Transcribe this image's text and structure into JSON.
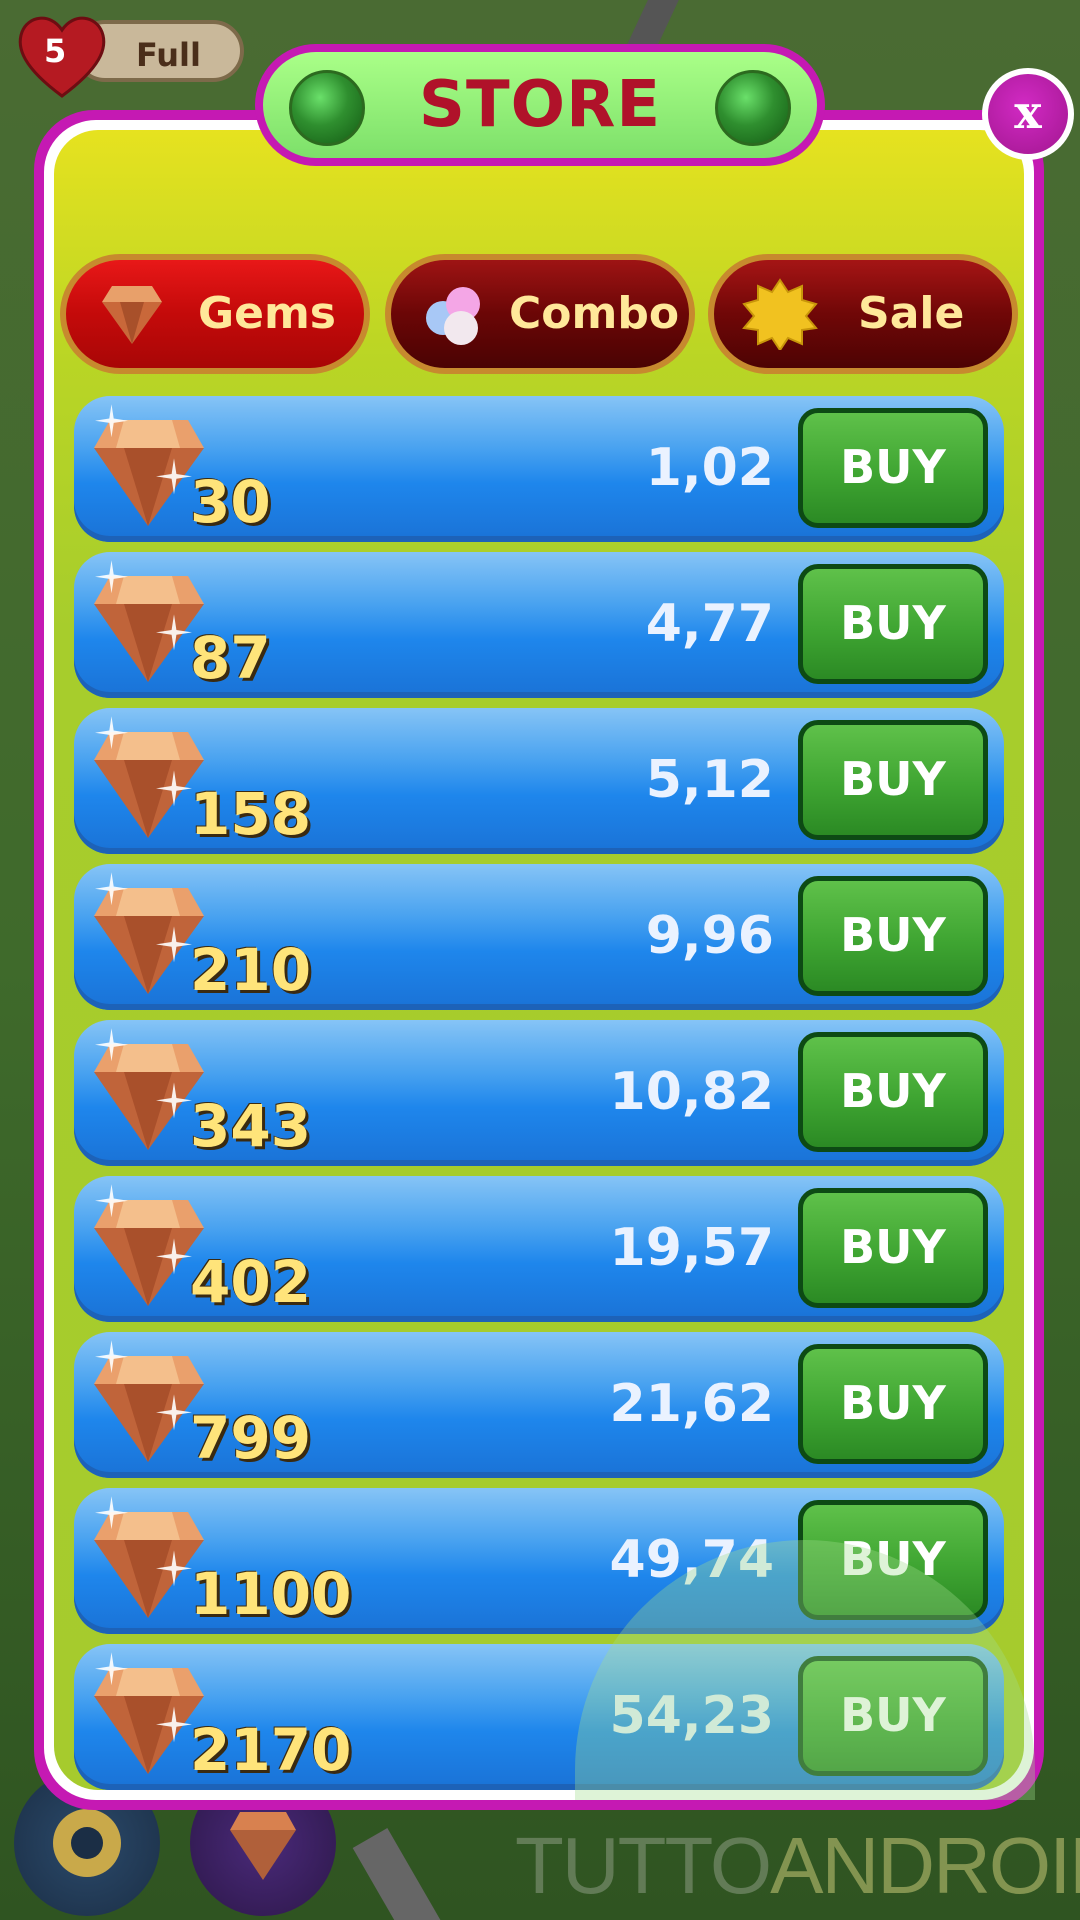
{
  "lives": {
    "count": "5",
    "status": "Full"
  },
  "store": {
    "title": "STORE",
    "close_label": "x"
  },
  "tabs": [
    {
      "label": "Gems"
    },
    {
      "label": "Combo"
    },
    {
      "label": "Sale"
    }
  ],
  "buy_label": "BUY",
  "packs": [
    {
      "amount": "30",
      "price": "1,02"
    },
    {
      "amount": "87",
      "price": "4,77"
    },
    {
      "amount": "158",
      "price": "5,12"
    },
    {
      "amount": "210",
      "price": "9,96"
    },
    {
      "amount": "343",
      "price": "10,82"
    },
    {
      "amount": "402",
      "price": "19,57"
    },
    {
      "amount": "799",
      "price": "21,62"
    },
    {
      "amount": "1100",
      "price": "49,74"
    },
    {
      "amount": "2170",
      "price": "54,23"
    }
  ],
  "watermark": {
    "part1": "TUTTO",
    "part2": "ANDROID"
  },
  "colors": {
    "frame": "#c519b3",
    "panel": "#a6cb2d",
    "row": "#1e86ec",
    "buy": "#3fa532",
    "title": "#b0122a"
  }
}
